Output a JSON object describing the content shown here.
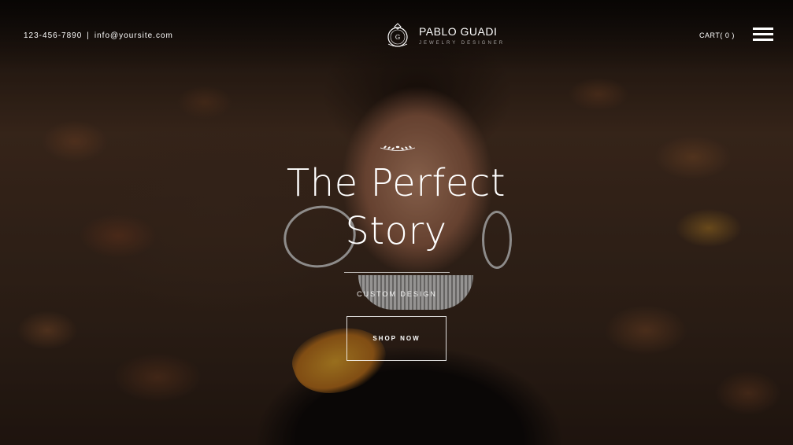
{
  "header": {
    "phone": "123-456-7890",
    "separator": "|",
    "email": "info@yoursite.com",
    "brand_name": "PABLO GUADI",
    "brand_tagline": "JEWELRY DESIGNER",
    "cart_label": "CART",
    "cart_count": "( 0 )",
    "menu_icon": "hamburger-menu-icon"
  },
  "hero": {
    "title_line1": "The Perfect",
    "title_line2": "Story",
    "subtitle": "CUSTOM DESIGN",
    "cta_label": "SHOP NOW",
    "ornament_icon": "laurel-ornament-icon"
  },
  "colors": {
    "text": "#ffffff",
    "overlay": "#000000",
    "leaf_accent": "#b26b1c"
  }
}
